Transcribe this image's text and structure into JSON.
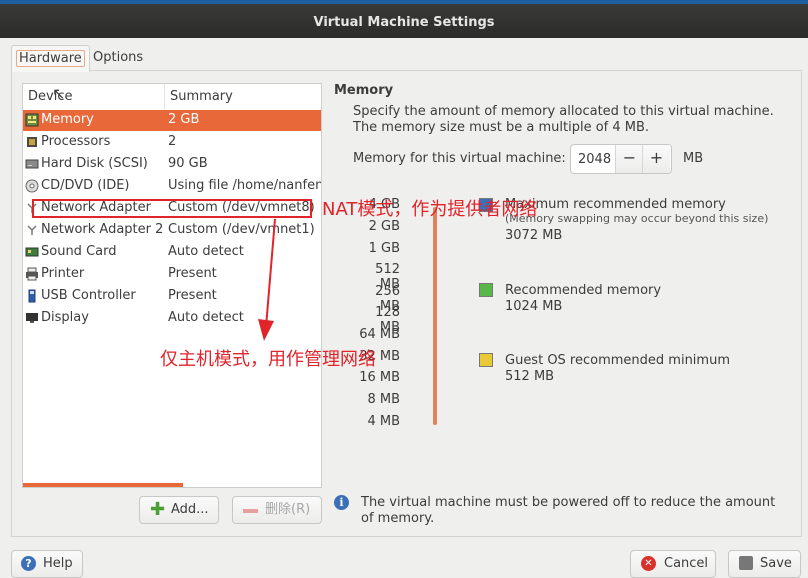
{
  "window": {
    "title": "Virtual Machine Settings"
  },
  "tabs": [
    {
      "label": "Hardware"
    },
    {
      "label": "Options"
    }
  ],
  "device_table": {
    "headers": {
      "device": "Device",
      "summary": "Summary"
    },
    "rows": [
      {
        "name": "Memory",
        "summary": "2 GB",
        "icon": "memory-icon"
      },
      {
        "name": "Processors",
        "summary": "2",
        "icon": "processor-icon"
      },
      {
        "name": "Hard Disk (SCSI)",
        "summary": "90 GB",
        "icon": "hard-disk-icon"
      },
      {
        "name": "CD/DVD (IDE)",
        "summary": "Using file /home/nanfeng",
        "icon": "cd-dvd-icon"
      },
      {
        "name": "Network Adapter",
        "summary": "Custom (/dev/vmnet8)",
        "icon": "network-icon"
      },
      {
        "name": "Network Adapter 2",
        "summary": "Custom (/dev/vmnet1)",
        "icon": "network-icon"
      },
      {
        "name": "Sound Card",
        "summary": "Auto detect",
        "icon": "sound-card-icon"
      },
      {
        "name": "Printer",
        "summary": "Present",
        "icon": "printer-icon"
      },
      {
        "name": "USB Controller",
        "summary": "Present",
        "icon": "usb-icon"
      },
      {
        "name": "Display",
        "summary": "Auto detect",
        "icon": "display-icon"
      }
    ]
  },
  "buttons": {
    "add": "Add...",
    "remove": "删除(R)",
    "help": "Help",
    "cancel": "Cancel",
    "save": "Save"
  },
  "memory": {
    "title": "Memory",
    "description": "Specify the amount of memory allocated to this virtual machine. The memory size must be a multiple of 4 MB.",
    "field_label": "Memory for this virtual machine:",
    "value": "2048",
    "unit": "MB",
    "scale": [
      "4 GB",
      "2 GB",
      "1 GB",
      "512 MB",
      "256 MB",
      "128 MB",
      "64 MB",
      "32 MB",
      "16 MB",
      "8 MB",
      "4 MB"
    ],
    "legend": [
      {
        "title": "Maximum recommended memory",
        "subtitle": "(Memory swapping may occur beyond this size)",
        "value": "3072 MB",
        "color": "#3b6fb6"
      },
      {
        "title": "Recommended memory",
        "subtitle": "",
        "value": "1024 MB",
        "color": "#57b847"
      },
      {
        "title": "Guest OS recommended minimum",
        "subtitle": "",
        "value": "512 MB",
        "color": "#e8c93a"
      }
    ],
    "info": "The virtual machine must be powered off to reduce the amount of memory."
  },
  "annotations": {
    "nat": "NAT模式，作为提供者网络",
    "host_only": "仅主机模式，用作管理网络"
  },
  "colors": {
    "accent": "#e9683a",
    "annotation": "#e0242a"
  }
}
